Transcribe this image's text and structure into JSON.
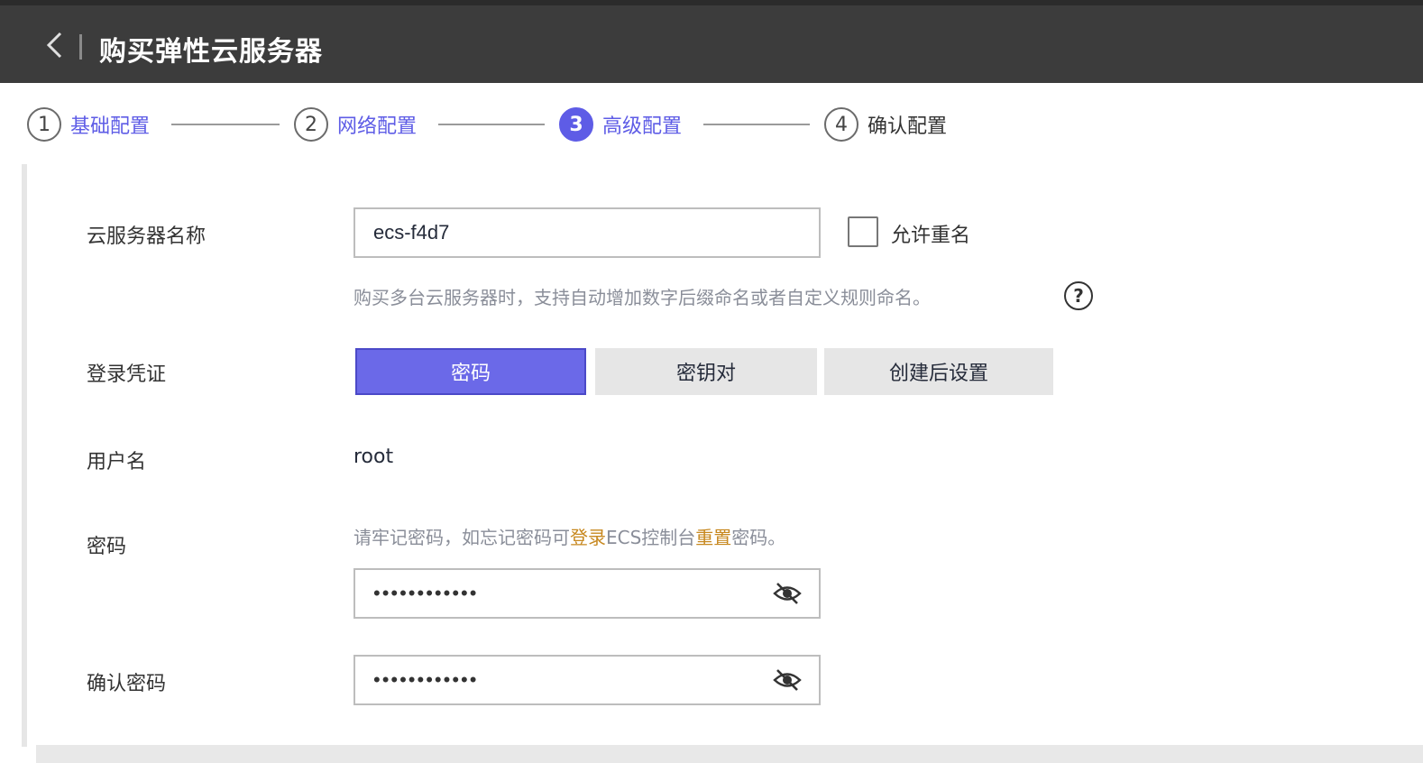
{
  "header": {
    "title": "购买弹性云服务器",
    "back_icon": "chevron-left-icon"
  },
  "steps": [
    {
      "number": "1",
      "label": "基础配置",
      "state": "done"
    },
    {
      "number": "2",
      "label": "网络配置",
      "state": "done"
    },
    {
      "number": "3",
      "label": "高级配置",
      "state": "active"
    },
    {
      "number": "4",
      "label": "确认配置",
      "state": "todo"
    }
  ],
  "form": {
    "server_name": {
      "label": "云服务器名称",
      "value": "ecs-f4d7",
      "allow_duplicate_label": "允许重名",
      "allow_duplicate_checked": false,
      "hint": "购买多台云服务器时，支持自动增加数字后缀命名或者自定义规则命名。",
      "help_icon": "question-circle-icon"
    },
    "credential": {
      "label": "登录凭证",
      "options": [
        "密码",
        "密钥对",
        "创建后设置"
      ],
      "selected": "密码"
    },
    "username": {
      "label": "用户名",
      "value": "root"
    },
    "password": {
      "label": "密码",
      "warning_prefix": "请牢记密码，如忘记密码可",
      "warning_link": "登录",
      "warning_middle": "ECS控制台",
      "warning_link2": "重置",
      "warning_suffix": "密码。",
      "value": "••••••••••••",
      "eye_icon": "eye-off-icon"
    },
    "confirm_password": {
      "label": "确认密码",
      "value": "••••••••••••",
      "eye_icon": "eye-off-icon"
    }
  },
  "colors": {
    "accent": "#5e5ce6",
    "topbar": "#3c3c3c",
    "warning": "#c7881f"
  }
}
